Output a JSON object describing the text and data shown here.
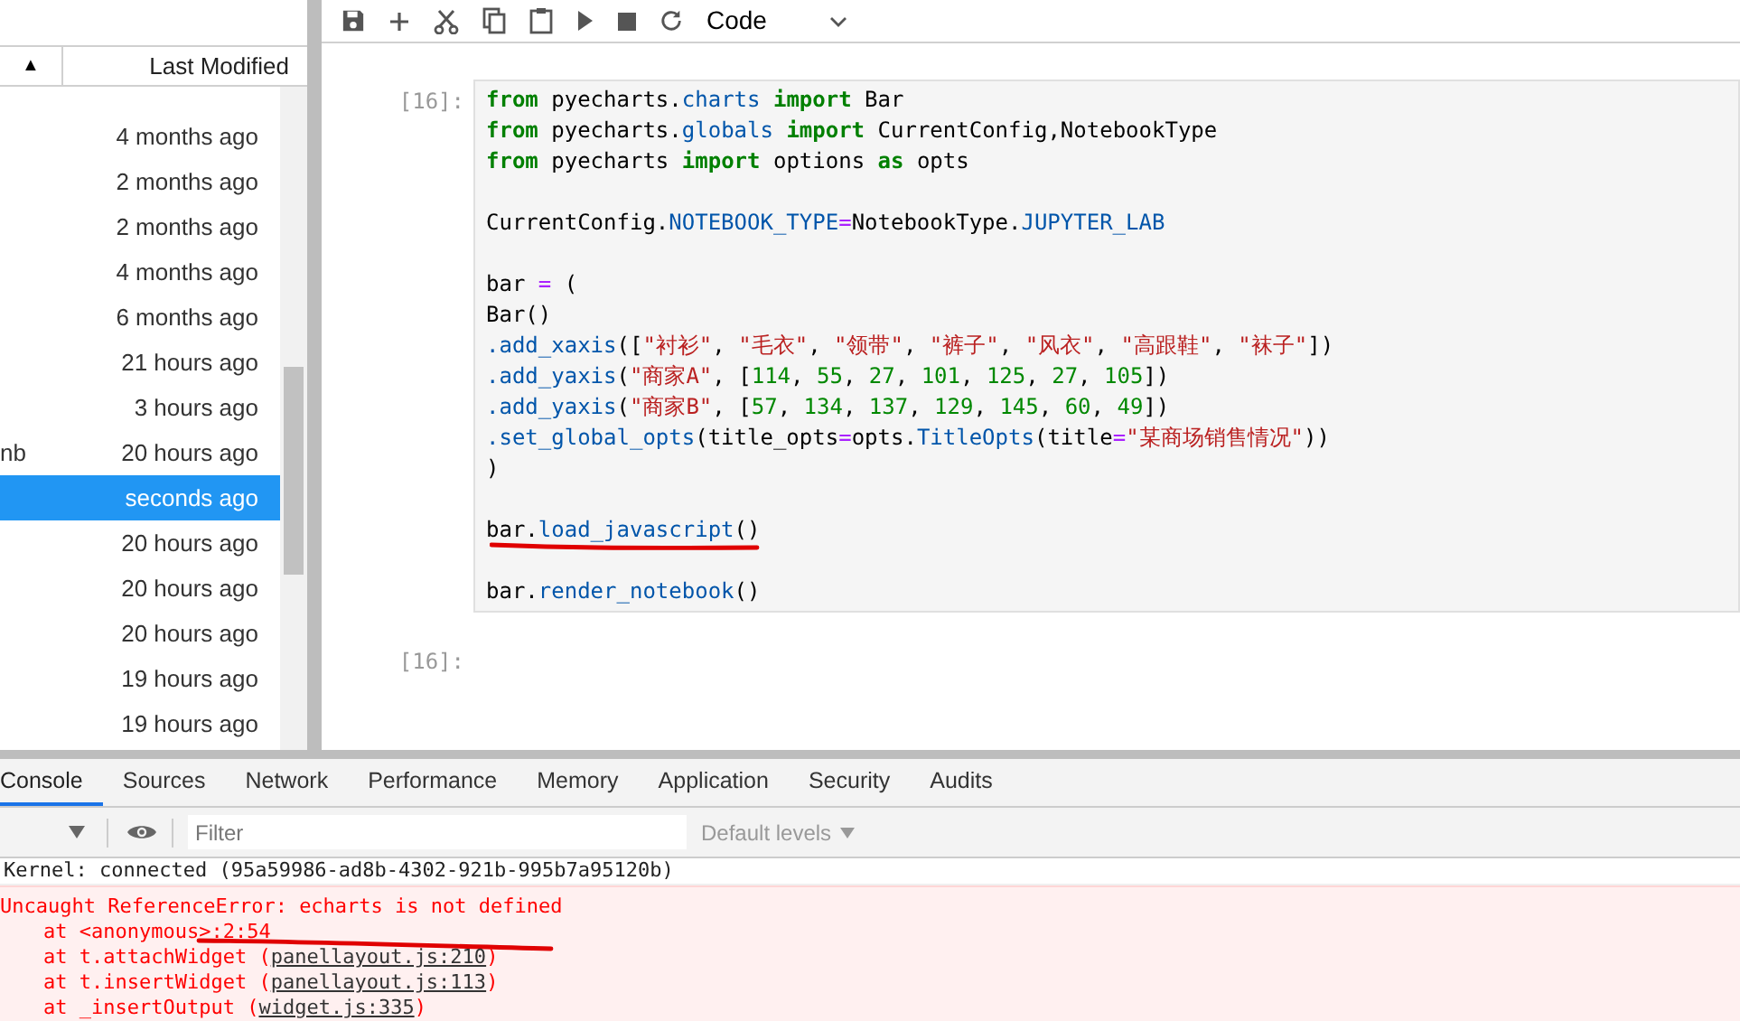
{
  "file_browser": {
    "columns": [
      {
        "label": "▲"
      },
      {
        "label": "Last Modified"
      }
    ],
    "rows": [
      {
        "modified": "4 months ago",
        "selected": false
      },
      {
        "modified": "2 months ago",
        "selected": false
      },
      {
        "modified": "2 months ago",
        "selected": false
      },
      {
        "modified": "4 months ago",
        "selected": false
      },
      {
        "modified": "6 months ago",
        "selected": false
      },
      {
        "modified": "21 hours ago",
        "selected": false
      },
      {
        "modified": "3 hours ago",
        "selected": false
      },
      {
        "name": "nb",
        "modified": "20 hours ago",
        "selected": false
      },
      {
        "modified": "seconds ago",
        "selected": true
      },
      {
        "modified": "20 hours ago",
        "selected": false
      },
      {
        "modified": "20 hours ago",
        "selected": false
      },
      {
        "modified": "20 hours ago",
        "selected": false
      },
      {
        "modified": "19 hours ago",
        "selected": false
      },
      {
        "modified": "19 hours ago",
        "selected": false
      }
    ]
  },
  "notebook": {
    "toolbar": {
      "cell_type": "Code"
    },
    "cells": [
      {
        "prompt": "[16]:",
        "lines": [
          {
            "kind": "code",
            "tokens": [
              {
                "kind": "keyword",
                "text": "from"
              },
              {
                "kind": "plain",
                "text": " pyecharts."
              },
              {
                "kind": "attr",
                "text": "charts "
              },
              {
                "kind": "keyword",
                "text": "import"
              },
              {
                "kind": "plain",
                "text": " Bar"
              }
            ]
          },
          {
            "kind": "code",
            "tokens": [
              {
                "kind": "keyword",
                "text": "from"
              },
              {
                "kind": "plain",
                "text": " pyecharts."
              },
              {
                "kind": "attr",
                "text": "globals "
              },
              {
                "kind": "keyword",
                "text": "import"
              },
              {
                "kind": "plain",
                "text": " CurrentConfig,NotebookType"
              }
            ]
          },
          {
            "kind": "code",
            "tokens": [
              {
                "kind": "keyword",
                "text": "from"
              },
              {
                "kind": "plain",
                "text": " pyecharts "
              },
              {
                "kind": "keyword",
                "text": "import"
              },
              {
                "kind": "plain",
                "text": " options "
              },
              {
                "kind": "keyword",
                "text": "as"
              },
              {
                "kind": "plain",
                "text": " opts"
              }
            ]
          },
          {
            "kind": "blank"
          },
          {
            "kind": "code",
            "tokens": [
              {
                "kind": "plain",
                "text": "CurrentConfig."
              },
              {
                "kind": "attr",
                "text": "NOTEBOOK_TYPE"
              },
              {
                "kind": "op",
                "text": "="
              },
              {
                "kind": "plain",
                "text": "NotebookType."
              },
              {
                "kind": "attr",
                "text": "JUPYTER_LAB"
              }
            ]
          },
          {
            "kind": "blank"
          },
          {
            "kind": "code",
            "tokens": [
              {
                "kind": "plain",
                "text": "bar "
              },
              {
                "kind": "op",
                "text": "="
              },
              {
                "kind": "plain",
                "text": " ("
              }
            ]
          },
          {
            "kind": "code",
            "tokens": [
              {
                "kind": "plain",
                "text": "Bar()"
              }
            ]
          },
          {
            "kind": "code",
            "tokens": [
              {
                "kind": "attr",
                "text": ".add_xaxis"
              },
              {
                "kind": "plain",
                "text": "(["
              },
              {
                "kind": "string",
                "text": "\"衬衫\""
              },
              {
                "kind": "plain",
                "text": ", "
              },
              {
                "kind": "string",
                "text": "\"毛衣\""
              },
              {
                "kind": "plain",
                "text": ", "
              },
              {
                "kind": "string",
                "text": "\"领带\""
              },
              {
                "kind": "plain",
                "text": ", "
              },
              {
                "kind": "string",
                "text": "\"裤子\""
              },
              {
                "kind": "plain",
                "text": ", "
              },
              {
                "kind": "string",
                "text": "\"风衣\""
              },
              {
                "kind": "plain",
                "text": ", "
              },
              {
                "kind": "string",
                "text": "\"高跟鞋\""
              },
              {
                "kind": "plain",
                "text": ", "
              },
              {
                "kind": "string",
                "text": "\"袜子\""
              },
              {
                "kind": "plain",
                "text": "])"
              }
            ]
          },
          {
            "kind": "code",
            "tokens": [
              {
                "kind": "attr",
                "text": ".add_yaxis"
              },
              {
                "kind": "plain",
                "text": "("
              },
              {
                "kind": "string",
                "text": "\"商家A\""
              },
              {
                "kind": "plain",
                "text": ", ["
              },
              {
                "kind": "number",
                "text": "114"
              },
              {
                "kind": "plain",
                "text": ", "
              },
              {
                "kind": "number",
                "text": "55"
              },
              {
                "kind": "plain",
                "text": ", "
              },
              {
                "kind": "number",
                "text": "27"
              },
              {
                "kind": "plain",
                "text": ", "
              },
              {
                "kind": "number",
                "text": "101"
              },
              {
                "kind": "plain",
                "text": ", "
              },
              {
                "kind": "number",
                "text": "125"
              },
              {
                "kind": "plain",
                "text": ", "
              },
              {
                "kind": "number",
                "text": "27"
              },
              {
                "kind": "plain",
                "text": ", "
              },
              {
                "kind": "number",
                "text": "105"
              },
              {
                "kind": "plain",
                "text": "])"
              }
            ]
          },
          {
            "kind": "code",
            "tokens": [
              {
                "kind": "attr",
                "text": ".add_yaxis"
              },
              {
                "kind": "plain",
                "text": "("
              },
              {
                "kind": "string",
                "text": "\"商家B\""
              },
              {
                "kind": "plain",
                "text": ", ["
              },
              {
                "kind": "number",
                "text": "57"
              },
              {
                "kind": "plain",
                "text": ", "
              },
              {
                "kind": "number",
                "text": "134"
              },
              {
                "kind": "plain",
                "text": ", "
              },
              {
                "kind": "number",
                "text": "137"
              },
              {
                "kind": "plain",
                "text": ", "
              },
              {
                "kind": "number",
                "text": "129"
              },
              {
                "kind": "plain",
                "text": ", "
              },
              {
                "kind": "number",
                "text": "145"
              },
              {
                "kind": "plain",
                "text": ", "
              },
              {
                "kind": "number",
                "text": "60"
              },
              {
                "kind": "plain",
                "text": ", "
              },
              {
                "kind": "number",
                "text": "49"
              },
              {
                "kind": "plain",
                "text": "])"
              }
            ]
          },
          {
            "kind": "code",
            "tokens": [
              {
                "kind": "attr",
                "text": ".set_global_opts"
              },
              {
                "kind": "plain",
                "text": "(title_opts"
              },
              {
                "kind": "op",
                "text": "="
              },
              {
                "kind": "plain",
                "text": "opts."
              },
              {
                "kind": "attr",
                "text": "TitleOpts"
              },
              {
                "kind": "plain",
                "text": "(title"
              },
              {
                "kind": "op",
                "text": "="
              },
              {
                "kind": "string",
                "text": "\"某商场销售情况\""
              },
              {
                "kind": "plain",
                "text": "))"
              }
            ]
          },
          {
            "kind": "code",
            "tokens": [
              {
                "kind": "plain",
                "text": ")"
              }
            ]
          },
          {
            "kind": "blank"
          },
          {
            "kind": "code",
            "underlined": true,
            "tokens": [
              {
                "kind": "plain",
                "text": "bar."
              },
              {
                "kind": "attr",
                "text": "load_javascript"
              },
              {
                "kind": "plain",
                "text": "()"
              }
            ]
          },
          {
            "kind": "blank"
          },
          {
            "kind": "code",
            "tokens": [
              {
                "kind": "plain",
                "text": "bar."
              },
              {
                "kind": "attr",
                "text": "render_notebook"
              },
              {
                "kind": "plain",
                "text": "()"
              }
            ]
          }
        ]
      },
      {
        "prompt": "[16]:"
      }
    ]
  },
  "devtools": {
    "tabs": [
      {
        "label": "Console",
        "selected": true
      },
      {
        "label": "Sources",
        "selected": false
      },
      {
        "label": "Network",
        "selected": false
      },
      {
        "label": "Performance",
        "selected": false
      },
      {
        "label": "Memory",
        "selected": false
      },
      {
        "label": "Application",
        "selected": false
      },
      {
        "label": "Security",
        "selected": false
      },
      {
        "label": "Audits",
        "selected": false
      }
    ],
    "filter": {
      "placeholder": "Filter"
    },
    "levels": "Default levels",
    "messages": [
      {
        "kind": "info",
        "text": "Kernel: connected (95a59986-ad8b-4302-921b-995b7a95120b)"
      },
      {
        "kind": "error",
        "text": "Uncaught ReferenceError: echarts is not defined",
        "stack": [
          {
            "text": "at <anonymous>:2:54"
          },
          {
            "text": "at t.attachWidget (",
            "link": "panellayout.js:210",
            "after": ")"
          },
          {
            "text": "at t.insertWidget (",
            "link": "panellayout.js:113",
            "after": ")"
          },
          {
            "text": "at _insertOutput (",
            "link": "widget.js:335",
            "after": ")"
          }
        ]
      }
    ]
  }
}
